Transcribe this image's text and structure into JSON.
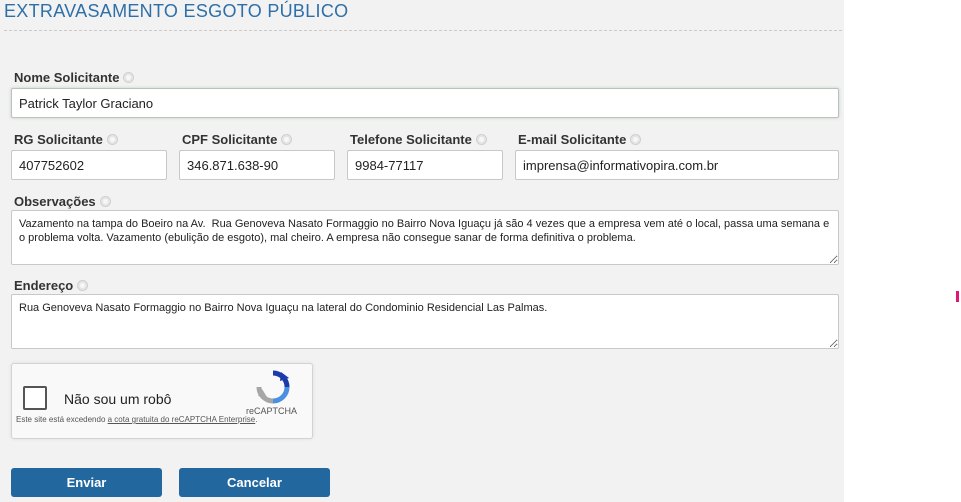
{
  "page": {
    "title": "EXTRAVASAMENTO ESGOTO PÚBLICO"
  },
  "form": {
    "nome": {
      "label": "Nome Solicitante",
      "value": "Patrick Taylor Graciano"
    },
    "rg": {
      "label": "RG Solicitante",
      "value": "407752602"
    },
    "cpf": {
      "label": "CPF Solicitante",
      "value": "346.871.638-90"
    },
    "telefone": {
      "label": "Telefone Solicitante",
      "value": "9984-77117"
    },
    "email": {
      "label": "E-mail Solicitante",
      "value": "imprensa@informativopira.com.br"
    },
    "observacoes": {
      "label": "Observações",
      "value": "Vazamento na tampa do Boeiro na Av.  Rua Genoveva Nasato Formaggio no Bairro Nova Iguaçu já são 4 vezes que a empresa vem até o local, passa uma semana e o problema volta. Vazamento (ebulição de esgoto), mal cheiro. A empresa não consegue sanar de forma definitiva o problema."
    },
    "endereco": {
      "label": "Endereço",
      "value": "Rua Genoveva Nasato Formaggio no Bairro Nova Iguaçu na lateral do Condominio Residencial Las Palmas."
    }
  },
  "recaptcha": {
    "checkbox_label": "Não sou um robô",
    "brand": "reCAPTCHA",
    "note_prefix": "Este site está excedendo ",
    "note_link": "a cota gratuita do reCAPTCHA Enterprise",
    "note_suffix": ".",
    "logo_icon": "recaptcha-logo-icon"
  },
  "buttons": {
    "submit": "Enviar",
    "cancel": "Cancelar"
  },
  "colors": {
    "title": "#2e6fa8",
    "button": "#23679f",
    "marker": "#e0157a"
  }
}
